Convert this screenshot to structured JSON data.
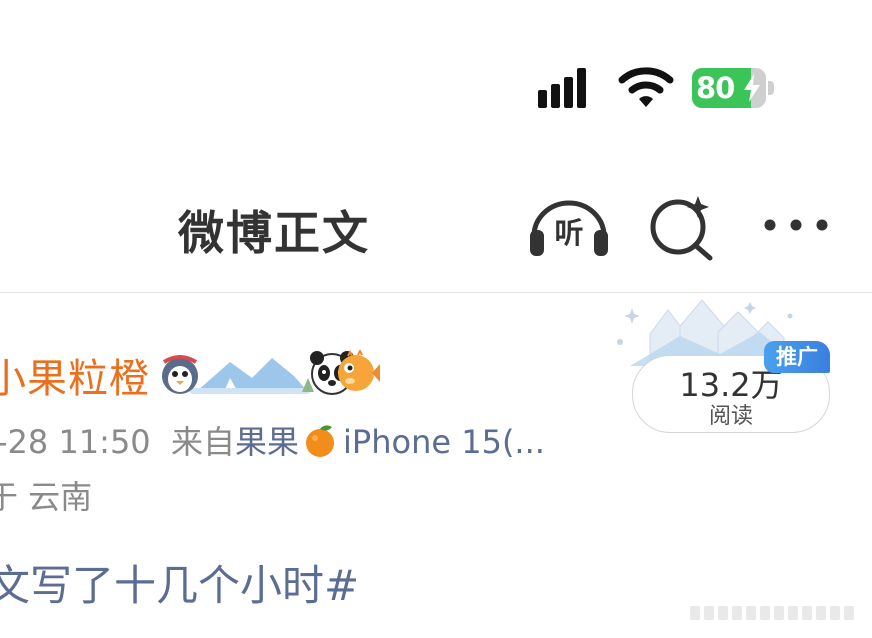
{
  "status_bar": {
    "battery_percent": "80",
    "battery_level": 0.8,
    "charging": true,
    "signal_icon": "cellular-signal-icon",
    "wifi_icon": "wifi-icon",
    "colors": {
      "battery_fill": "#3bc458"
    }
  },
  "nav": {
    "title": "微博正文",
    "listen_label": "听",
    "search_icon": "ai-search-icon",
    "more_icon": "more-dots-icon"
  },
  "post": {
    "author": "小果粒橙",
    "meta": {
      "time": "-28 11:50",
      "source_prefix": "来自",
      "source_name": "果果",
      "device": "iPhone 15(..."
    },
    "location": "于 云南",
    "views": {
      "count": "13.2万",
      "label": "阅读"
    },
    "promo_tag": "推广",
    "text": "文写了十几个小时#",
    "colors": {
      "author": "#ea6f1f",
      "link": "#5b6d92",
      "meta": "#8a8a8a"
    }
  }
}
